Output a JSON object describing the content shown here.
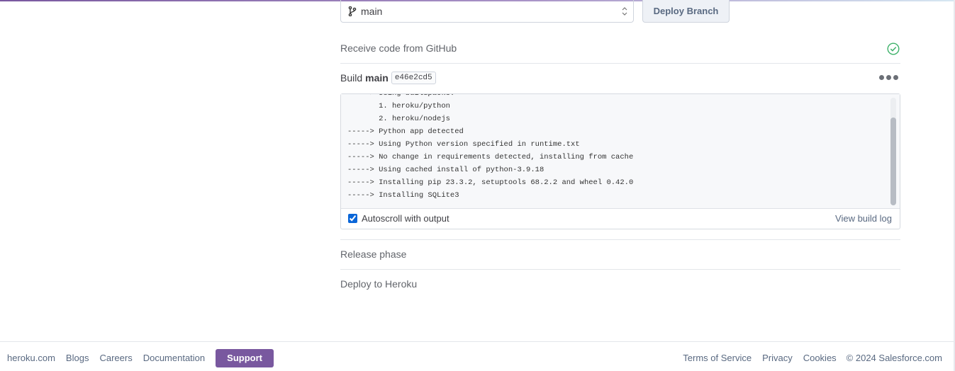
{
  "deploy": {
    "branch_value": "main",
    "deploy_button": "Deploy Branch"
  },
  "steps": {
    "receive": "Receive code from GitHub",
    "build_prefix": "Build",
    "build_branch": "main",
    "build_sha": "e46e2cd5",
    "release": "Release phase",
    "deploy": "Deploy to Heroku"
  },
  "log": {
    "lines": [
      "-----> Using buildpacks:",
      "       1. heroku/python",
      "       2. heroku/nodejs",
      "-----> Python app detected",
      "-----> Using Python version specified in runtime.txt",
      "-----> No change in requirements detected, installing from cache",
      "-----> Using cached install of python-3.9.18",
      "-----> Installing pip 23.3.2, setuptools 68.2.2 and wheel 0.42.0",
      "-----> Installing SQLite3"
    ],
    "autoscroll_label": "Autoscroll with output",
    "autoscroll_checked": true,
    "view_build_log": "View build log"
  },
  "icons": {
    "branch": "git-branch-icon",
    "select_arrows": "sort-arrows-icon",
    "status": "check-circle-icon",
    "more": "more-dots-icon"
  },
  "colors": {
    "brand_purple": "#79589f",
    "success_green": "#3fb26b"
  },
  "footer": {
    "left_links": [
      "heroku.com",
      "Blogs",
      "Careers",
      "Documentation"
    ],
    "support": "Support",
    "right_links": [
      "Terms of Service",
      "Privacy",
      "Cookies"
    ],
    "copyright": "© 2024 Salesforce.com"
  }
}
